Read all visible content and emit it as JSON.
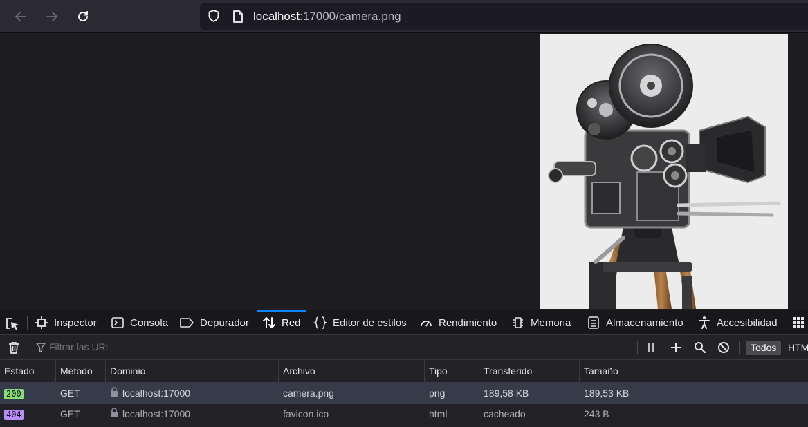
{
  "browser": {
    "url_host": "localhost",
    "url_rest": ":17000/camera.png",
    "back_icon": "arrow-left-icon",
    "forward_icon": "arrow-right-icon",
    "reload_icon": "reload-icon"
  },
  "devtools": {
    "tabs": [
      {
        "label": "Inspector",
        "icon": "inspector-icon"
      },
      {
        "label": "Consola",
        "icon": "console-icon"
      },
      {
        "label": "Depurador",
        "icon": "debugger-icon"
      },
      {
        "label": "Red",
        "icon": "network-icon",
        "active": true
      },
      {
        "label": "Editor de estilos",
        "icon": "style-editor-icon"
      },
      {
        "label": "Rendimiento",
        "icon": "performance-icon"
      },
      {
        "label": "Memoria",
        "icon": "memory-icon"
      },
      {
        "label": "Almacenamiento",
        "icon": "storage-icon"
      },
      {
        "label": "Accesibilidad",
        "icon": "accessibility-icon"
      }
    ],
    "filter_placeholder": "Filtrar las URL",
    "filter_buttons": [
      "Todos",
      "HTML"
    ],
    "columns": [
      "Estado",
      "Método",
      "Dominio",
      "Archivo",
      "Tipo",
      "Transferido",
      "Tamaño"
    ],
    "rows": [
      {
        "status": "200",
        "method": "GET",
        "domain": "localhost:17000",
        "file": "camera.png",
        "type": "png",
        "transferred": "189,58 KB",
        "size": "189,53 KB"
      },
      {
        "status": "404",
        "method": "GET",
        "domain": "localhost:17000",
        "file": "favicon.ico",
        "type": "html",
        "transferred": "cacheado",
        "size": "243 B"
      }
    ]
  },
  "colors": {
    "accent": "#0a84ff",
    "status_ok": "#86de74",
    "status_not_found": "#b98eff"
  }
}
